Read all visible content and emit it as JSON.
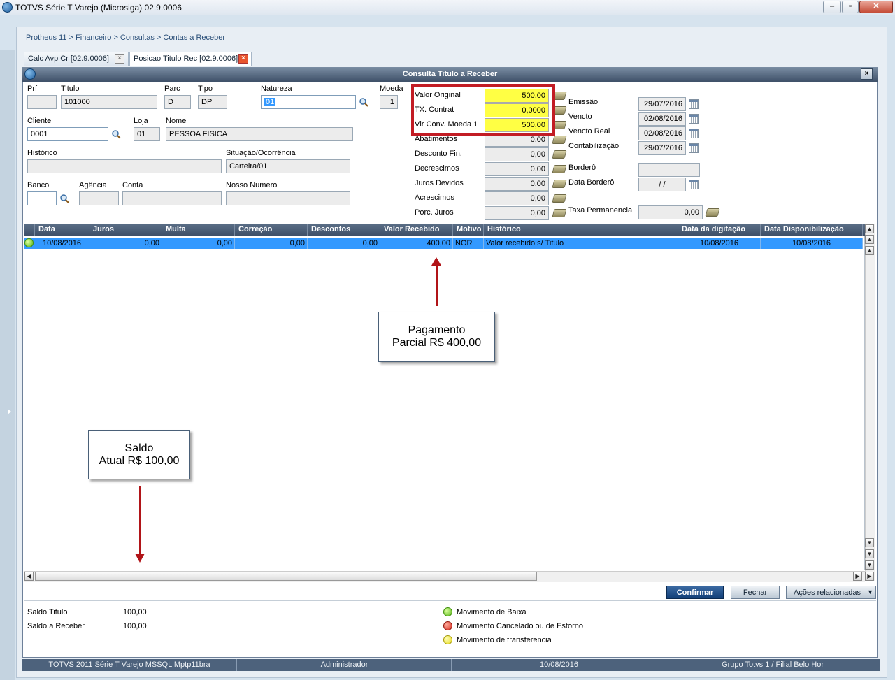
{
  "window": {
    "title": "TOTVS Série T Varejo (Microsiga) 02.9.0006"
  },
  "breadcrumb": "Protheus 11 > Financeiro > Consultas > Contas a Receber",
  "tabs": [
    {
      "label": "Calc Avp Cr [02.9.0006]"
    },
    {
      "label": "Posicao Titulo Rec [02.9.0006]"
    }
  ],
  "dialog": {
    "title": "Consulta Titulo a Receber"
  },
  "form": {
    "prf": {
      "label": "Prf",
      "value": ""
    },
    "titulo": {
      "label": "Titulo",
      "value": "101000"
    },
    "parc": {
      "label": "Parc",
      "value": "D"
    },
    "tipo": {
      "label": "Tipo",
      "value": "DP"
    },
    "natureza": {
      "label": "Natureza",
      "value": "01"
    },
    "moeda": {
      "label": "Moeda",
      "value": "1"
    },
    "cliente": {
      "label": "Cliente",
      "value": "0001"
    },
    "loja": {
      "label": "Loja",
      "value": "01"
    },
    "nome": {
      "label": "Nome",
      "value": "PESSOA FISICA"
    },
    "historico": {
      "label": "Histórico",
      "value": ""
    },
    "situacao": {
      "label": "Situação/Ocorrência",
      "value": "Carteira/01"
    },
    "banco": {
      "label": "Banco",
      "value": ""
    },
    "agencia": {
      "label": "Agência",
      "value": ""
    },
    "conta": {
      "label": "Conta",
      "value": ""
    },
    "nosso_numero": {
      "label": "Nosso Numero",
      "value": ""
    }
  },
  "values": [
    {
      "label": "Valor Original",
      "value": "500,00"
    },
    {
      "label": "TX. Contrat",
      "value": "0,0000"
    },
    {
      "label": "Vlr Conv. Moeda 1",
      "value": "500,00"
    },
    {
      "label": "Abatimentos",
      "value": "0,00"
    },
    {
      "label": "Desconto Fin.",
      "value": "0,00"
    },
    {
      "label": "Decrescimos",
      "value": "0,00"
    },
    {
      "label": "Juros Devidos",
      "value": "0,00"
    },
    {
      "label": "Acrescimos",
      "value": "0,00"
    },
    {
      "label": "Porc. Juros",
      "value": "0,00"
    }
  ],
  "dates": [
    {
      "label": "Emissão",
      "value": "29/07/2016"
    },
    {
      "label": "Vencto",
      "value": "02/08/2016"
    },
    {
      "label": "Vencto Real",
      "value": "02/08/2016"
    },
    {
      "label": "Contabilização",
      "value": "29/07/2016"
    }
  ],
  "bordero": {
    "label": "Borderô",
    "value": ""
  },
  "data_bordero": {
    "label": "Data Borderô",
    "value": " / /"
  },
  "taxa_permanencia": {
    "label": "Taxa Permanencia",
    "value": "0,00"
  },
  "grid": {
    "columns": [
      "Data",
      "Juros",
      "Multa",
      "Correção",
      "Descontos",
      "Valor Recebido",
      "Motivo",
      "Histórico",
      "Data da digitação",
      "Data Disponibilização"
    ],
    "rows": [
      [
        "10/08/2016",
        "0,00",
        "0,00",
        "0,00",
        "0,00",
        "400,00",
        "NOR",
        "Valor recebido s/ Titulo",
        "10/08/2016",
        "10/08/2016"
      ]
    ]
  },
  "buttons": {
    "confirm": "Confirmar",
    "close": "Fechar",
    "actions": "Ações relacionadas"
  },
  "summary": {
    "saldo_titulo": {
      "label": "Saldo Titulo",
      "value": "100,00"
    },
    "saldo_receber": {
      "label": "Saldo a Receber",
      "value": "100,00"
    }
  },
  "legend": [
    {
      "label": "Movimento de Baixa",
      "color": "#57b417"
    },
    {
      "label": "Movimento Cancelado ou de Estorno",
      "color": "#d42216"
    },
    {
      "label": "Movimento de transferencia",
      "color": "#e6d81a"
    }
  ],
  "statusbar": [
    "TOTVS 2011 Série T Varejo MSSQL Mptp11bra",
    "Administrador",
    "10/08/2016",
    "Grupo Totvs 1 / Filial Belo Hor"
  ],
  "annotations": {
    "pagamento": {
      "line1": "Pagamento",
      "line2": "Parcial R$ 400,00"
    },
    "saldo": {
      "line1": "Saldo",
      "line2": "Atual R$ 100,00"
    }
  },
  "icons": [
    "app-icon",
    "search-icon",
    "money-icon",
    "calendar-icon",
    "close-icon"
  ]
}
